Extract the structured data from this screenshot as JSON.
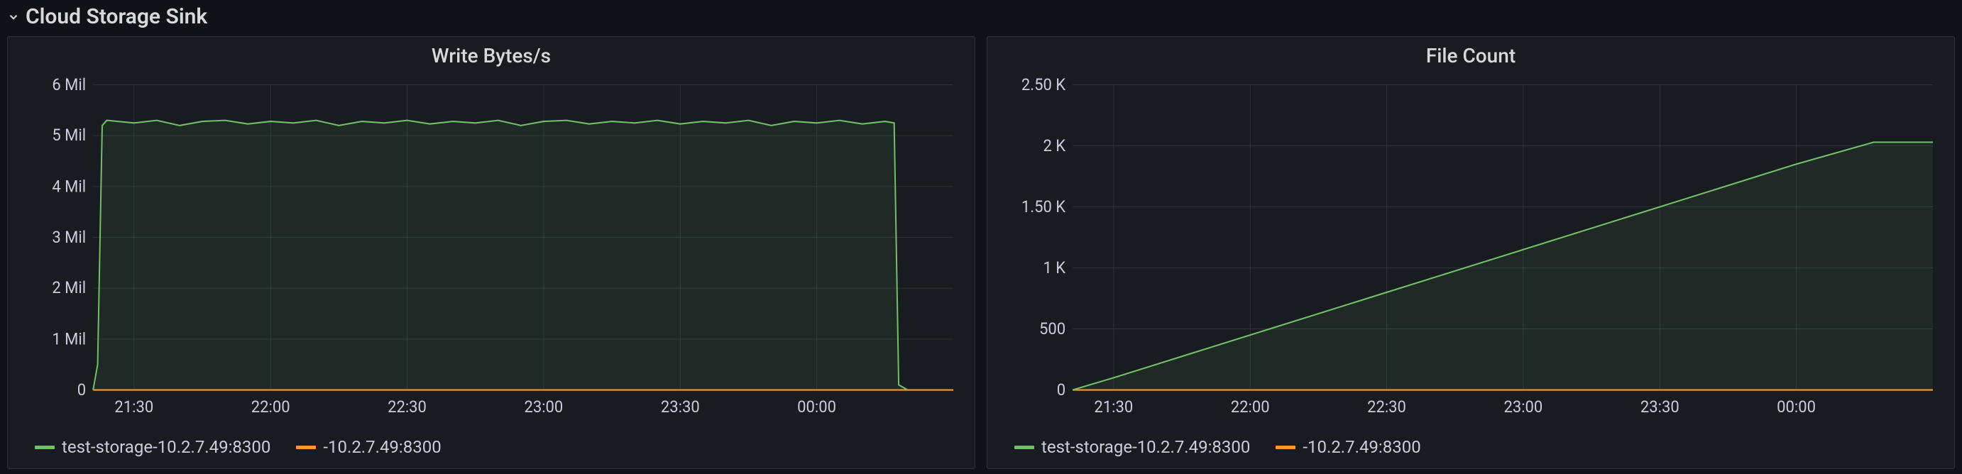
{
  "section": {
    "title": "Cloud Storage Sink"
  },
  "panels": [
    {
      "title": "Write Bytes/s",
      "legend": [
        {
          "label": "test-storage-10.2.7.49:8300",
          "color": "green"
        },
        {
          "label": "-10.2.7.49:8300",
          "color": "orange"
        }
      ]
    },
    {
      "title": "File Count",
      "legend": [
        {
          "label": "test-storage-10.2.7.49:8300",
          "color": "green"
        },
        {
          "label": "-10.2.7.49:8300",
          "color": "orange"
        }
      ]
    }
  ],
  "chart_data": [
    {
      "type": "line",
      "title": "Write Bytes/s",
      "xlabel": "",
      "ylabel": "",
      "ylim": [
        0,
        6000000
      ],
      "x_ticks": [
        "21:30",
        "22:00",
        "22:30",
        "23:00",
        "23:30",
        "00:00"
      ],
      "y_ticks": [
        "0",
        "1 Mil",
        "2 Mil",
        "3 Mil",
        "4 Mil",
        "5 Mil",
        "6 Mil"
      ],
      "x": [
        "21:21",
        "21:22",
        "21:23",
        "21:24",
        "21:30",
        "21:35",
        "21:40",
        "21:45",
        "21:50",
        "21:55",
        "22:00",
        "22:05",
        "22:10",
        "22:15",
        "22:20",
        "22:25",
        "22:30",
        "22:35",
        "22:40",
        "22:45",
        "22:50",
        "22:55",
        "23:00",
        "23:05",
        "23:10",
        "23:15",
        "23:20",
        "23:25",
        "23:30",
        "23:35",
        "23:40",
        "23:45",
        "23:50",
        "23:55",
        "00:00",
        "00:05",
        "00:10",
        "00:15",
        "00:17",
        "00:18",
        "00:20"
      ],
      "series": [
        {
          "name": "test-storage-10.2.7.49:8300",
          "values": [
            0,
            500000,
            5200000,
            5300000,
            5250000,
            5300000,
            5200000,
            5280000,
            5300000,
            5230000,
            5280000,
            5250000,
            5300000,
            5200000,
            5280000,
            5250000,
            5300000,
            5230000,
            5280000,
            5250000,
            5300000,
            5200000,
            5280000,
            5300000,
            5230000,
            5280000,
            5250000,
            5300000,
            5230000,
            5280000,
            5250000,
            5300000,
            5200000,
            5280000,
            5250000,
            5300000,
            5230000,
            5280000,
            5250000,
            100000,
            0
          ]
        },
        {
          "name": "-10.2.7.49:8300",
          "values": [
            0,
            0,
            0,
            0,
            0,
            0,
            0,
            0,
            0,
            0,
            0,
            0,
            0,
            0,
            0,
            0,
            0,
            0,
            0,
            0,
            0,
            0,
            0,
            0,
            0,
            0,
            0,
            0,
            0,
            0,
            0,
            0,
            0,
            0,
            0,
            0,
            0,
            0,
            0,
            0,
            0
          ]
        }
      ]
    },
    {
      "type": "line",
      "title": "File Count",
      "xlabel": "",
      "ylabel": "",
      "ylim": [
        0,
        2500
      ],
      "x_ticks": [
        "21:30",
        "22:00",
        "22:30",
        "23:00",
        "23:30",
        "00:00"
      ],
      "y_ticks": [
        "0",
        "500",
        "1 K",
        "1.50 K",
        "2 K",
        "2.50 K"
      ],
      "x": [
        "21:21",
        "21:30",
        "22:00",
        "22:30",
        "23:00",
        "23:30",
        "00:00",
        "00:17",
        "00:30"
      ],
      "series": [
        {
          "name": "test-storage-10.2.7.49:8300",
          "values": [
            0,
            100,
            450,
            800,
            1150,
            1500,
            1850,
            2030,
            2030
          ]
        },
        {
          "name": "-10.2.7.49:8300",
          "values": [
            0,
            0,
            0,
            0,
            0,
            0,
            0,
            0,
            0
          ]
        }
      ]
    }
  ]
}
